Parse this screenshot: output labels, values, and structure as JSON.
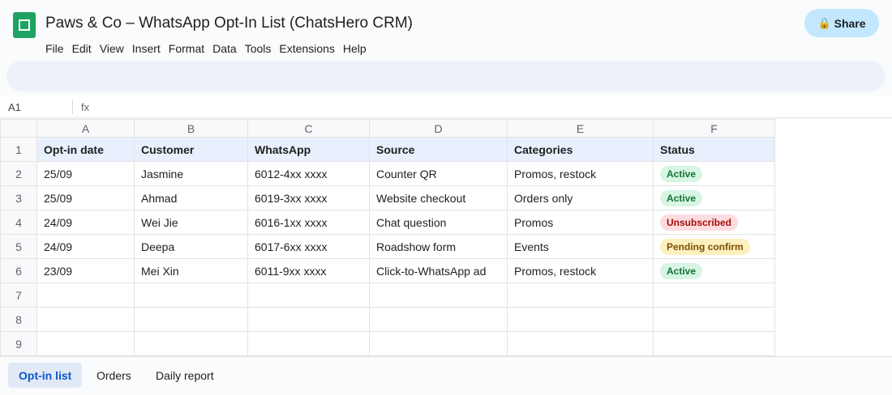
{
  "doc": {
    "title": "Paws & Co – WhatsApp Opt-In List (ChatsHero CRM)",
    "logo": "sheets-logo-icon"
  },
  "menu": [
    "File",
    "Edit",
    "View",
    "Insert",
    "Format",
    "Data",
    "Tools",
    "Extensions",
    "Help"
  ],
  "share": {
    "label": "Share",
    "icon": "lock-icon",
    "glyph": "🔒"
  },
  "formula_bar": {
    "cell_ref": "A1",
    "fx": "fx",
    "value": ""
  },
  "columns": [
    "A",
    "B",
    "C",
    "D",
    "E",
    "F"
  ],
  "row_numbers": [
    "1",
    "2",
    "3",
    "4",
    "5",
    "6",
    "7",
    "8",
    "9"
  ],
  "header": [
    "Opt-in date",
    "Customer",
    "WhatsApp",
    "Source",
    "Categories",
    "Status"
  ],
  "rows": [
    {
      "date": "25/09",
      "customer": "Jasmine",
      "whatsapp": "6012-4xx xxxx",
      "source": "Counter QR",
      "categories": "Promos, restock",
      "status": "Active",
      "status_kind": "active"
    },
    {
      "date": "25/09",
      "customer": "Ahmad",
      "whatsapp": "6019-3xx xxxx",
      "source": "Website checkout",
      "categories": "Orders only",
      "status": "Active",
      "status_kind": "active"
    },
    {
      "date": "24/09",
      "customer": "Wei Jie",
      "whatsapp": "6016-1xx xxxx",
      "source": "Chat question",
      "categories": "Promos",
      "status": "Unsubscribed",
      "status_kind": "unsub"
    },
    {
      "date": "24/09",
      "customer": "Deepa",
      "whatsapp": "6017-6xx xxxx",
      "source": "Roadshow form",
      "categories": "Events",
      "status": "Pending confirm",
      "status_kind": "pending"
    },
    {
      "date": "23/09",
      "customer": "Mei Xin",
      "whatsapp": "6011-9xx xxxx",
      "source": "Click-to-WhatsApp ad",
      "categories": "Promos, restock",
      "status": "Active",
      "status_kind": "active"
    }
  ],
  "tabs": [
    {
      "label": "Opt-in list",
      "selected": true
    },
    {
      "label": "Orders",
      "selected": false
    },
    {
      "label": "Daily report",
      "selected": false
    }
  ],
  "colors": {
    "brand_green": "#1ea362",
    "share_bg": "#c2e7ff",
    "header_row_bg": "#e8f0fe",
    "active": "#137333",
    "unsubscribed": "#a50e0e",
    "pending": "#7a4f01"
  }
}
